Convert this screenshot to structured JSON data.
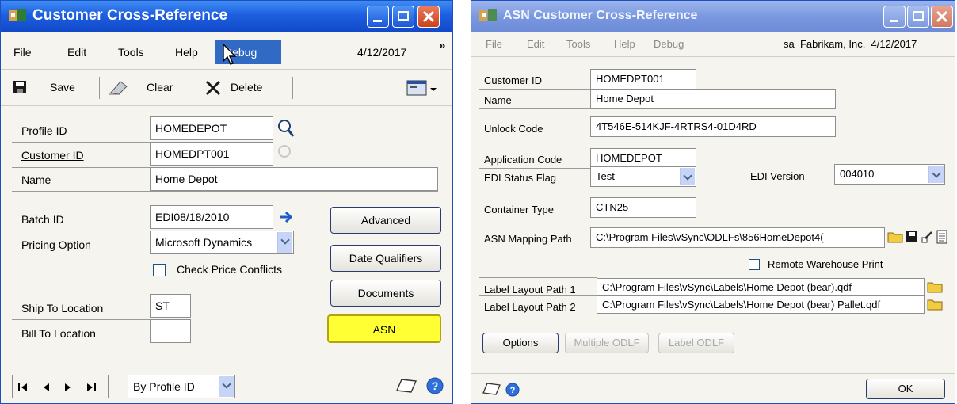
{
  "left_window": {
    "title": "Customer Cross-Reference",
    "menu": [
      "File",
      "Edit",
      "Tools",
      "Help",
      "Debug"
    ],
    "menu_date": "4/12/2017",
    "overflow_glyph": "»",
    "toolbar": {
      "save": "Save",
      "clear": "Clear",
      "delete": "Delete"
    },
    "fields": {
      "profile_id_label": "Profile ID",
      "profile_id": "HOMEDEPOT",
      "customer_id_label": "Customer ID",
      "customer_id": "HOMEDPT001",
      "name_label": "Name",
      "name": "Home Depot",
      "batch_id_label": "Batch ID",
      "batch_id": "EDI08/18/2010",
      "pricing_label": "Pricing Option",
      "pricing": "Microsoft Dynamics",
      "check_price_label": "Check Price Conflicts",
      "ship_to_label": "Ship To Location",
      "ship_to": "ST",
      "bill_to_label": "Bill To Location",
      "bill_to": ""
    },
    "buttons": {
      "advanced": "Advanced",
      "date_qualifiers": "Date Qualifiers",
      "documents": "Documents",
      "asn": "ASN"
    },
    "sort_by": "By Profile ID",
    "colors": {
      "asn_button": "#ffff33",
      "titlebar": "#1d5fe0"
    }
  },
  "right_window": {
    "title": "ASN Customer Cross-Reference",
    "menu": [
      "File",
      "Edit",
      "Tools",
      "Help",
      "Debug"
    ],
    "menu_status": "sa  Fabrikam, Inc.  4/12/2017",
    "fields": {
      "customer_id_label": "Customer ID",
      "customer_id": "HOMEDPT001",
      "name_label": "Name",
      "name": "Home Depot",
      "unlock_label": "Unlock Code",
      "unlock": "4T546E-514KJF-4RTRS4-01D4RD",
      "app_code_label": "Application Code",
      "app_code": "HOMEDEPOT",
      "edi_status_label": "EDI Status Flag",
      "edi_status": "Test",
      "edi_version_label": "EDI Version",
      "edi_version": "004010",
      "container_label": "Container Type",
      "container": "CTN25",
      "asn_path_label": "ASN Mapping Path",
      "asn_path": "C:\\Program Files\\vSync\\ODLFs\\856HomeDepot4(",
      "remote_label": "Remote Warehouse Print",
      "label1_label": "Label Layout Path 1",
      "label1": "C:\\Program Files\\vSync\\Labels\\Home Depot (bear).qdf",
      "label2_label": "Label Layout Path 2",
      "label2": "C:\\Program Files\\vSync\\Labels\\Home Depot (bear) Pallet.qdf"
    },
    "buttons": {
      "options": "Options",
      "multiple_odlf": "Multiple ODLF",
      "label_odlf": "Label ODLF",
      "ok": "OK"
    }
  }
}
